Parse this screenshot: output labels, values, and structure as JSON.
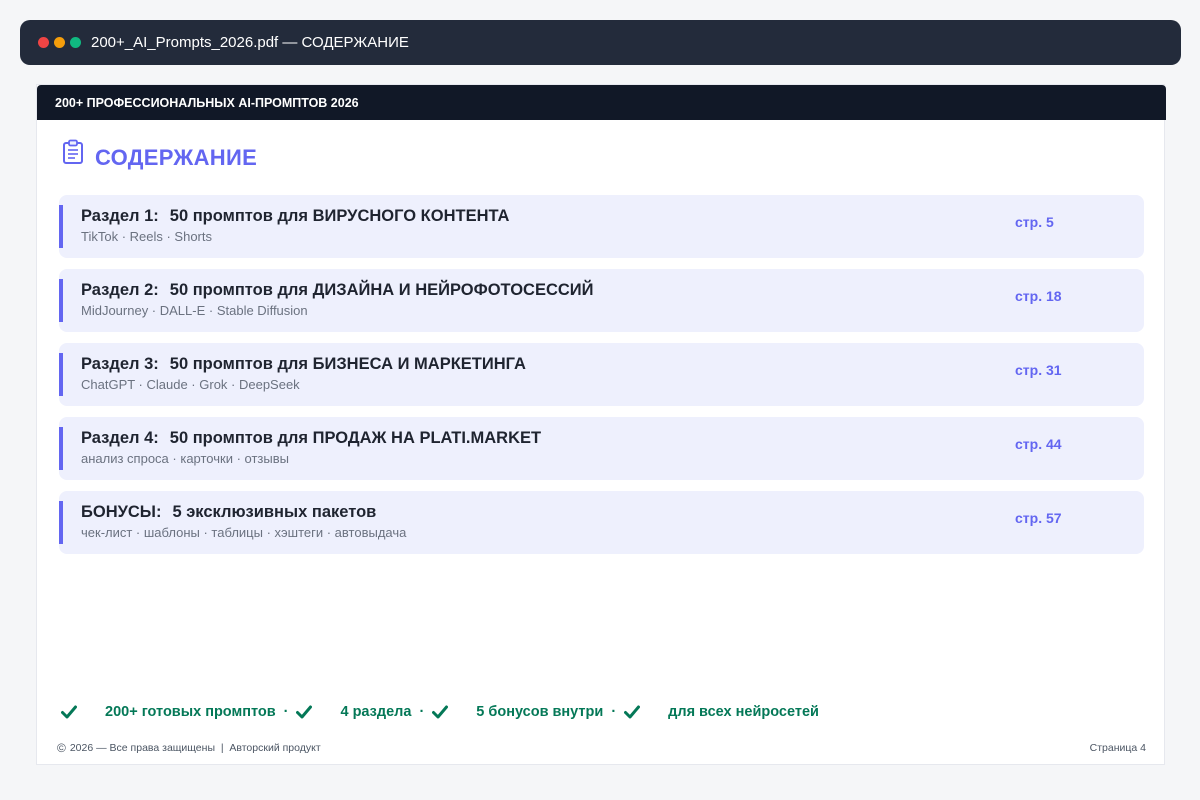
{
  "window": {
    "title": "200+_AI_Prompts_2026.pdf — СОДЕРЖАНИЕ",
    "dot_colors": [
      "#ef4444",
      "#f59e0b",
      "#10b981"
    ]
  },
  "page": {
    "header": "200+ ПРОФЕССИОНАЛЬНЫХ AI-ПРОМПТОВ 2026",
    "heading": "СОДЕРЖАНИЕ",
    "heading_icon": "clipboard-icon",
    "accent_color": "#6366f1",
    "toc": [
      {
        "label": "Раздел 1:",
        "title": "50 промптов для ВИРУСНОГО КОНТЕНТА",
        "tags": "TikTok · Reels · Shorts",
        "page": "стр. 5"
      },
      {
        "label": "Раздел 2:",
        "title": "50 промптов для ДИЗАЙНА И НЕЙРОФОТОСЕССИЙ",
        "tags": "MidJourney · DALL-E · Stable Diffusion",
        "page": "стр. 18"
      },
      {
        "label": "Раздел 3:",
        "title": "50 промптов для БИЗНЕСА И МАРКЕТИНГА",
        "tags": "ChatGPT · Claude · Grok · DeepSeek",
        "page": "стр. 31"
      },
      {
        "label": "Раздел 4:",
        "title": "50 промптов для ПРОДАЖ НА PLATI.MARKET",
        "tags": "анализ спроса · карточки · отзывы",
        "page": "стр. 44"
      },
      {
        "label": "БОНУСЫ:",
        "title": "5 эксклюзивных пакетов",
        "tags": "чек-лист · шаблоны · таблицы · хэштеги · автовыдача",
        "page": "стр. 57"
      }
    ],
    "features": [
      "200+ готовых промптов",
      "4 раздела",
      "5 бонусов внутри",
      "для всех нейросетей"
    ],
    "feature_separator": "·",
    "feature_color": "#047857",
    "footer_left": "2026 — Все права защищены  |  Авторский продукт",
    "footer_right": "Страница 4"
  }
}
